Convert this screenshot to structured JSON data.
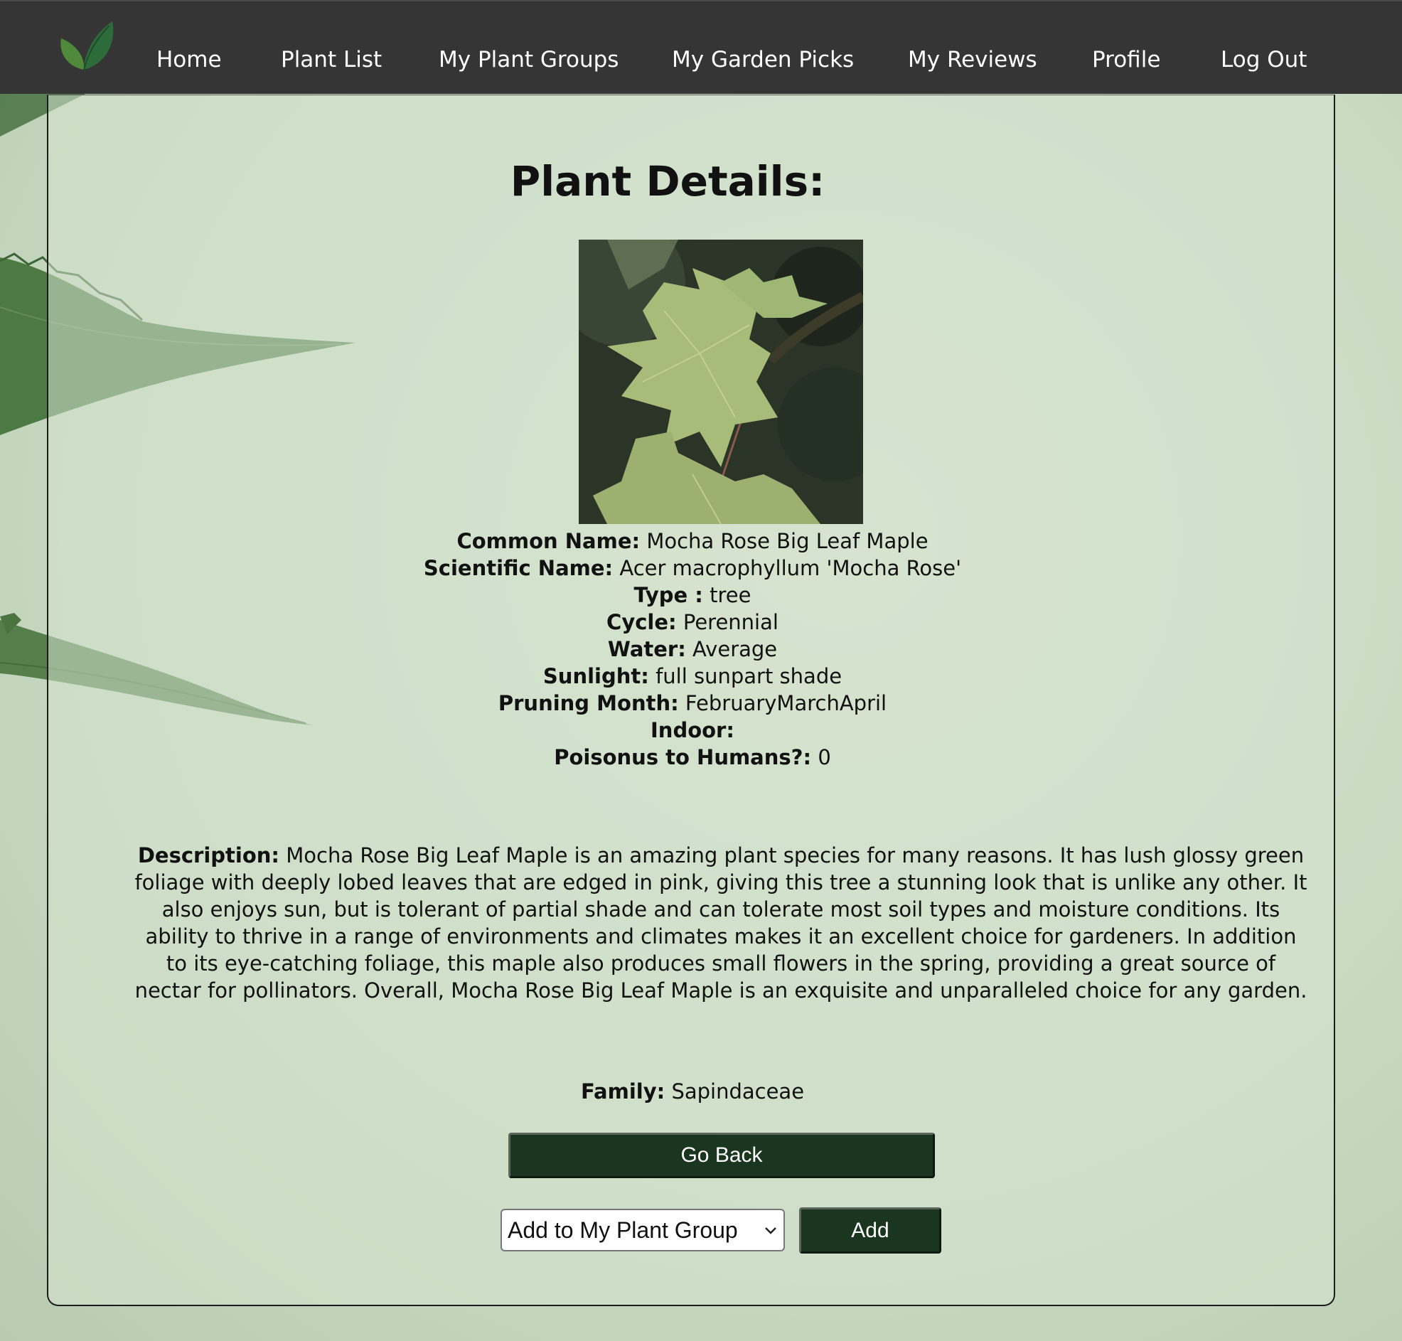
{
  "nav": {
    "logo_icon": "leaf-icon",
    "items": [
      {
        "label": "Home"
      },
      {
        "label": "Plant List"
      },
      {
        "label": "My Plant Groups"
      },
      {
        "label": "My Garden Picks"
      },
      {
        "label": "My Reviews"
      },
      {
        "label": "Profile"
      },
      {
        "label": "Log Out"
      }
    ]
  },
  "page": {
    "title": "Plant Details:"
  },
  "plant": {
    "common_name_label": "Common Name:",
    "common_name": "Mocha Rose Big Leaf Maple",
    "scientific_name_label": "Scientific Name:",
    "scientific_name": "Acer macrophyllum 'Mocha Rose'",
    "type_label": "Type :",
    "type": "tree",
    "cycle_label": "Cycle:",
    "cycle": "Perennial",
    "water_label": "Water:",
    "water": "Average",
    "sunlight_label": "Sunlight:",
    "sunlight": "full sunpart shade",
    "pruning_label": "Pruning Month:",
    "pruning": "FebruaryMarchApril",
    "indoor_label": "Indoor:",
    "indoor": "",
    "poisonous_label": "Poisonus to Humans?:",
    "poisonous": "0",
    "description_label": "Description:",
    "description": "Mocha Rose Big Leaf Maple is an amazing plant species for many reasons. It has lush glossy green foliage with deeply lobed leaves that are edged in pink, giving this tree a stunning look that is unlike any other. It also enjoys sun, but is tolerant of partial shade and can tolerate most soil types and moisture conditions. Its ability to thrive in a range of environments and climates makes it an excellent choice for gardeners. In addition to its eye-catching foliage, this maple also produces small flowers in the spring, providing a great source of nectar for pollinators. Overall, Mocha Rose Big Leaf Maple is an exquisite and unparalleled choice for any garden.",
    "family_label": "Family:",
    "family": "Sapindaceae"
  },
  "actions": {
    "go_back_label": "Go Back",
    "group_select_value": "Add to My Plant Group",
    "add_label": "Add"
  },
  "colors": {
    "navbar": "#353535",
    "button": "#1a3520",
    "background": "#c9dac3"
  }
}
